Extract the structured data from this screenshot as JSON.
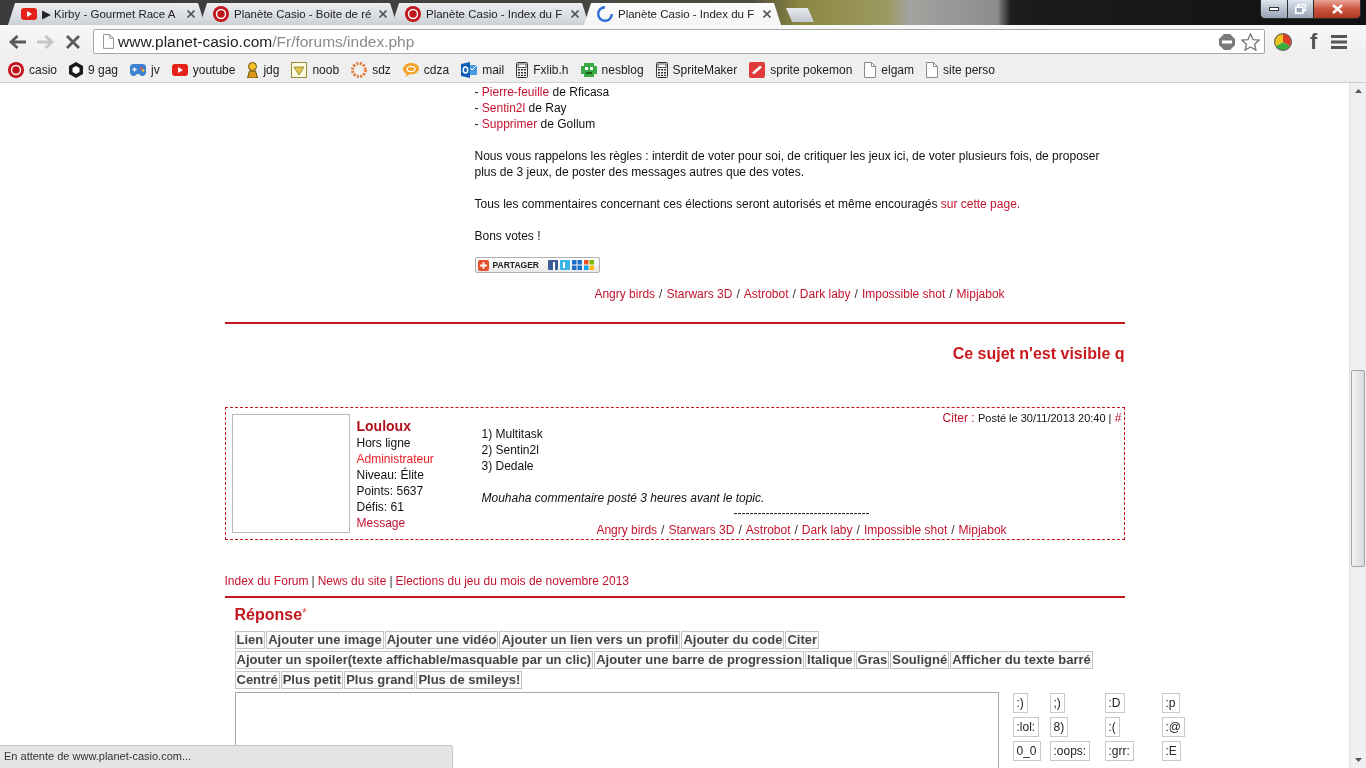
{
  "browser": {
    "tabs": [
      {
        "title": "▶ Kirby - Gourmet Race A",
        "selected": false,
        "loading": false
      },
      {
        "title": "Planète Casio - Boite de ré",
        "selected": false,
        "loading": false
      },
      {
        "title": "Planète Casio - Index du F",
        "selected": false,
        "loading": false
      },
      {
        "title": "Planète Casio - Index du F",
        "selected": true,
        "loading": true
      }
    ],
    "nav_buttons": [
      {
        "kind": "back",
        "disabled": false
      },
      {
        "kind": "forward",
        "disabled": true
      },
      {
        "kind": "stop",
        "disabled": false
      }
    ],
    "address": {
      "host": "www.planet-casio.com",
      "path": "/Fr/forums/index.php"
    },
    "extensions": [
      {
        "kind": "ring"
      },
      {
        "kind": "letter",
        "label": "f"
      }
    ],
    "bookmarks": [
      {
        "label": "casio"
      },
      {
        "label": "9 gag"
      },
      {
        "label": "jv"
      },
      {
        "label": "youtube"
      },
      {
        "label": "jdg"
      },
      {
        "label": "noob"
      },
      {
        "label": "sdz"
      },
      {
        "label": "cdza"
      },
      {
        "label": "mail"
      },
      {
        "label": "Fxlib.h"
      },
      {
        "label": "nesblog"
      },
      {
        "label": "SpriteMaker"
      },
      {
        "label": "sprite pokemon"
      },
      {
        "label": "elgam"
      },
      {
        "label": "site perso"
      }
    ],
    "status_bubble": "En attente de www.planet-casio.com..."
  },
  "topic": {
    "entries": [
      {
        "dash": "-",
        "link": "Pierre-feuille",
        "text": "de Rficasa"
      },
      {
        "dash": "-",
        "link": "Sentin2l",
        "text": "de Ray"
      },
      {
        "dash": "-",
        "link": "Supprimer",
        "text": "de Gollum"
      }
    ],
    "paragraphs": [
      {
        "text": "Nous vous rappelons les règles : interdit de voter pour soi, de critiquer les jeux ici, de voter plusieurs fois, de proposer plus de 3 jeux, de poster des messages autres que des votes."
      },
      {
        "text": "Tous les commentaires concernant ces élections seront autorisés et même encouragés",
        "link": "sur cette page."
      },
      {
        "text": "Bons votes !"
      }
    ],
    "share_button": {
      "label": "PARTAGER"
    },
    "signature": [
      {
        "label": "Angry birds",
        "separator": "/"
      },
      {
        "label": "Starwars 3D",
        "separator": "/"
      },
      {
        "label": "Astrobot",
        "separator": "/"
      },
      {
        "label": "Dark laby",
        "separator": "/"
      },
      {
        "label": "Impossible shot",
        "separator": "/"
      },
      {
        "label": "Mipjabok"
      }
    ]
  },
  "notice": "Ce sujet n'est visible q",
  "post": {
    "author": "Louloux",
    "status": "Hors ligne",
    "role": "Administrateur",
    "rank": "Niveau: Élite",
    "points": "Points: 5637",
    "challenges": "Défis: 61",
    "message_link": "Message",
    "quote_link": "Citer :",
    "date": "Posté le 30/11/2013 20:40 |",
    "anchor": "#",
    "lines": [
      "1) Multitask",
      "2) Sentin2l",
      "3) Dedale"
    ],
    "comment": "Mouhaha commentaire posté 3 heures avant le topic.",
    "signature_rule": "----------------------------------",
    "signature": [
      {
        "label": "Angry birds",
        "separator": "/"
      },
      {
        "label": "Starwars 3D",
        "separator": "/"
      },
      {
        "label": "Astrobot",
        "separator": "/"
      },
      {
        "label": "Dark laby",
        "separator": "/"
      },
      {
        "label": "Impossible shot",
        "separator": "/"
      },
      {
        "label": "Mipjabok"
      }
    ]
  },
  "breadcrumb": [
    {
      "label": "Index du Forum",
      "separator": "|"
    },
    {
      "label": "News du site",
      "separator": "|"
    },
    {
      "label": "Elections du jeu du mois de novembre 2013"
    }
  ],
  "reply": {
    "title": "Réponse",
    "required_mark": "*",
    "format_buttons": [
      [
        "Lien",
        "Ajouter une image",
        "Ajouter une vidéo",
        "Ajouter un lien vers un profil",
        "Ajouter du code",
        "Citer"
      ],
      [
        "Ajouter un spoiler(texte affichable/masquable par un clic)",
        "Ajouter une barre de progression",
        "Italique",
        "Gras",
        "Souligné",
        "Afficher du texte barré"
      ],
      [
        "Centré",
        "Plus petit",
        "Plus grand",
        "Plus de smileys!"
      ]
    ],
    "smileys": [
      [
        ":)",
        ";)",
        ":D",
        ":p"
      ],
      [
        ":lol:",
        "8)",
        ":(",
        ":@"
      ],
      [
        "0_0",
        ":oops:",
        ":grr:",
        ":E"
      ]
    ]
  }
}
